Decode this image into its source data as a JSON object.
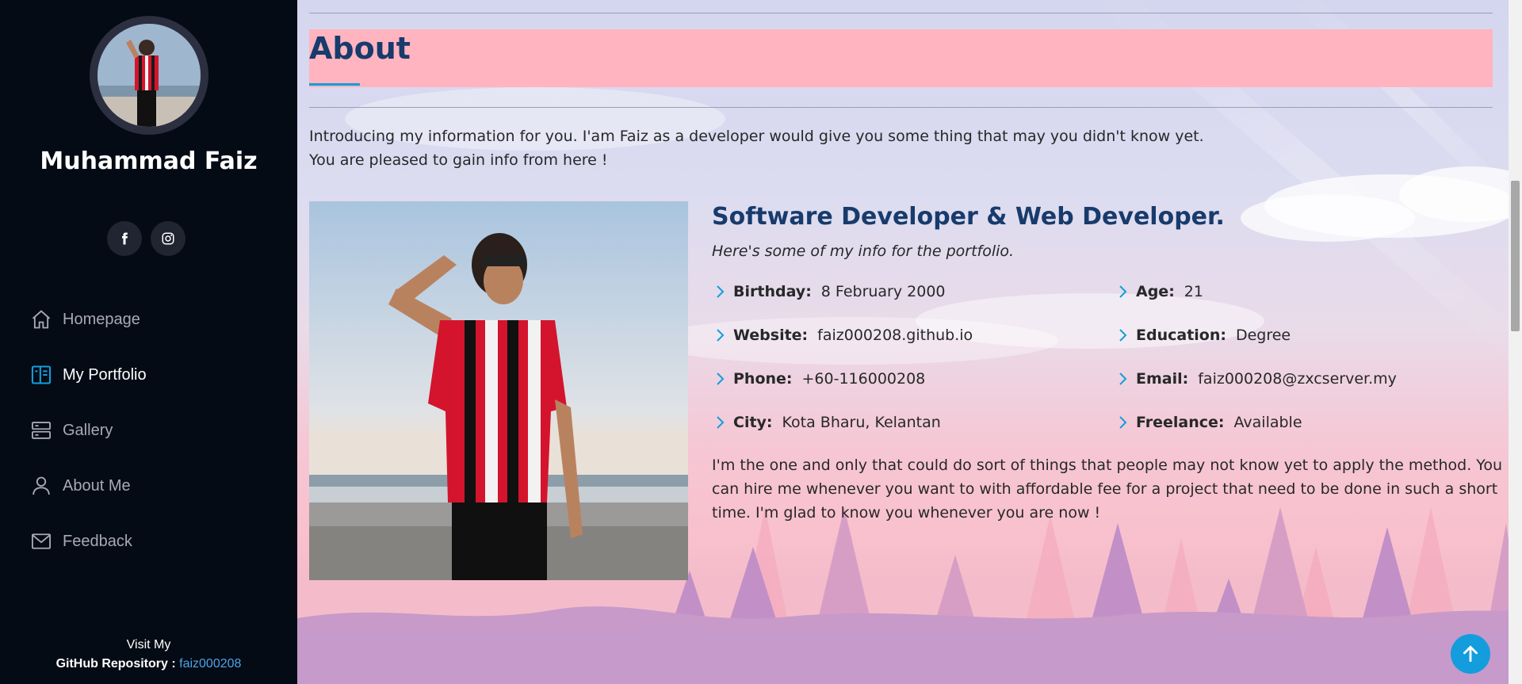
{
  "sidebar": {
    "name": "Muhammad Faiz",
    "social": [
      {
        "icon": "facebook-icon"
      },
      {
        "icon": "instagram-icon"
      }
    ],
    "nav": [
      {
        "label": "Homepage",
        "icon": "home-icon",
        "active": false
      },
      {
        "label": "My Portfolio",
        "icon": "portfolio-icon",
        "active": true
      },
      {
        "label": "Gallery",
        "icon": "server-icon",
        "active": false
      },
      {
        "label": "About Me",
        "icon": "person-icon",
        "active": false
      },
      {
        "label": "Feedback",
        "icon": "envelope-icon",
        "active": false
      }
    ],
    "github": {
      "line1": "Visit My",
      "label": "GitHub Repository :",
      "link_text": "faiz000208"
    }
  },
  "about": {
    "title": "About",
    "intro_line1": "Introducing my information for you. I'am Faiz as a developer would give you some thing that may you didn't know yet.",
    "intro_line2": "You are pleased to gain info from here !",
    "role": "Software Developer & Web Developer.",
    "tagline": "Here's some of my info for the portfolio.",
    "details_left": [
      {
        "key": "Birthday:",
        "value": "8 February 2000"
      },
      {
        "key": "Website:",
        "value": "faiz000208.github.io"
      },
      {
        "key": "Phone:",
        "value": "+60-116000208"
      },
      {
        "key": "City:",
        "value": "Kota Bharu, Kelantan"
      }
    ],
    "details_right": [
      {
        "key": "Age:",
        "value": "21"
      },
      {
        "key": "Education:",
        "value": "Degree"
      },
      {
        "key": "Email:",
        "value": "faiz000208@zxcserver.my"
      },
      {
        "key": "Freelance:",
        "value": "Available"
      }
    ],
    "bio": "I'm the one and only that could do sort of things that people may not know yet to apply the method. You can hire me whenever you want to with affordable fee for a project that need to be done in such a short time. I'm glad to know you whenever you are now !"
  },
  "colors": {
    "accent": "#149ddd",
    "heading": "#173b6c",
    "sidebar_bg": "#040b14",
    "title_band": "#ffb4c0"
  }
}
